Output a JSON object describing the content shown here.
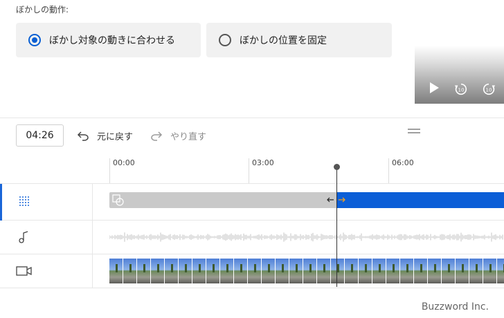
{
  "blur": {
    "section_label": "ぼかしの動作:",
    "options": [
      {
        "label": "ぼかし対象の動きに合わせる",
        "selected": true
      },
      {
        "label": "ぼかしの位置を固定",
        "selected": false
      }
    ]
  },
  "preview": {
    "play_icon": "play-icon",
    "skip_back_label": "10",
    "skip_forward_label": "10"
  },
  "toolbar": {
    "current_time": "04:26",
    "undo_label": "元に戻す",
    "redo_label": "やり直す"
  },
  "timeline": {
    "ticks": [
      "00:00",
      "03:00",
      "06:00"
    ],
    "tracks": [
      {
        "name": "blur-track",
        "icon": "blur-dots-icon",
        "selected": true
      },
      {
        "name": "audio-track",
        "icon": "music-note-icon",
        "selected": false
      },
      {
        "name": "video-track",
        "icon": "video-camera-icon",
        "selected": false
      }
    ]
  },
  "colors": {
    "accent": "#0b5ed7",
    "clip_gray": "#c9c9c9"
  },
  "brand": "Buzzword Inc."
}
